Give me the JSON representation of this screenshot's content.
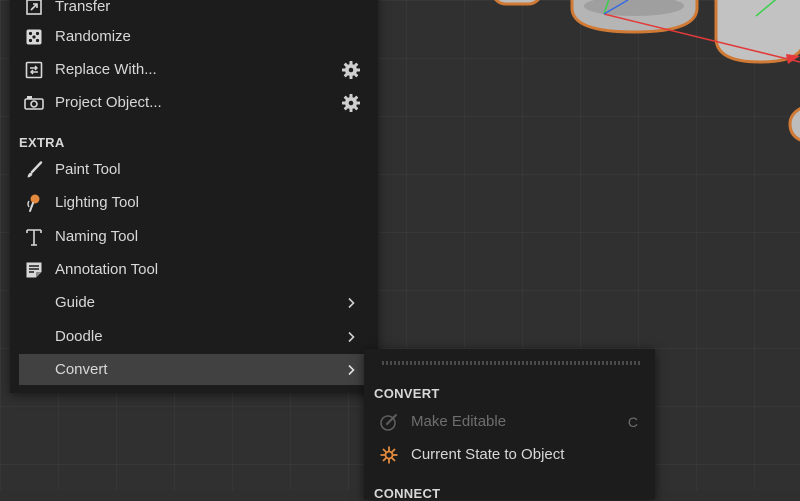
{
  "menu": {
    "items": [
      {
        "label": "Transfer",
        "icon": "transfer-icon"
      },
      {
        "label": "Randomize",
        "icon": "dice-icon"
      },
      {
        "label": "Replace With...",
        "icon": "replace-icon",
        "has_settings": true
      },
      {
        "label": "Project Object...",
        "icon": "project-icon",
        "has_settings": true
      }
    ],
    "extra_section": "EXTRA",
    "extra_items": [
      {
        "label": "Paint Tool",
        "icon": "brush-icon"
      },
      {
        "label": "Lighting Tool",
        "icon": "lighting-icon"
      },
      {
        "label": "Naming Tool",
        "icon": "text-icon"
      },
      {
        "label": "Annotation Tool",
        "icon": "annotation-icon"
      },
      {
        "label": "Guide",
        "submenu": true
      },
      {
        "label": "Doodle",
        "submenu": true
      },
      {
        "label": "Convert",
        "submenu": true,
        "active": true
      }
    ]
  },
  "submenu": {
    "section": "CONVERT",
    "items": [
      {
        "label": "Make Editable",
        "shortcut": "C",
        "disabled": true,
        "icon": "make-editable-icon"
      },
      {
        "label": "Current State to Object",
        "icon": "current-state-icon"
      }
    ],
    "next_section": "CONNECT"
  },
  "colors": {
    "menu_bg": "#1c1c1c",
    "active_row": "#414141",
    "accent_orange": "#e58a3c",
    "viewport_bg": "#303030"
  }
}
